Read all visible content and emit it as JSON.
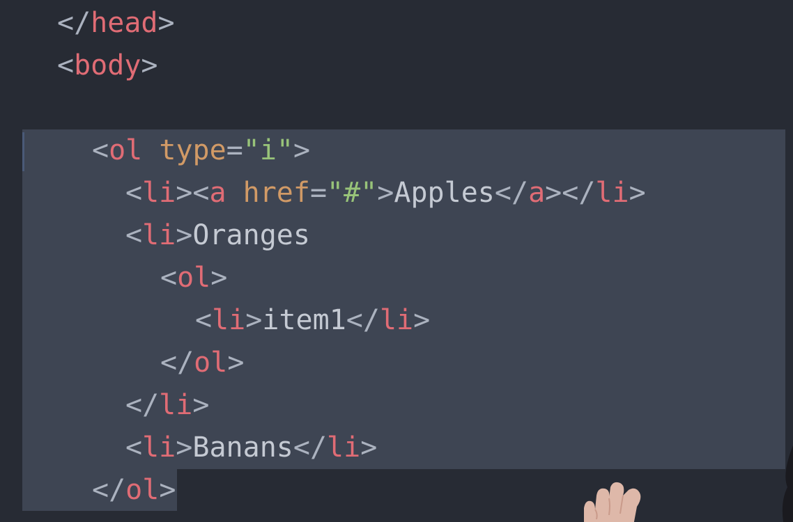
{
  "code_lines": [
    [
      {
        "t": "</",
        "c": "punct"
      },
      {
        "t": "head",
        "c": "tag"
      },
      {
        "t": ">",
        "c": "punct"
      }
    ],
    [
      {
        "t": "<",
        "c": "punct"
      },
      {
        "t": "body",
        "c": "tag"
      },
      {
        "t": ">",
        "c": "punct"
      }
    ],
    [],
    [
      {
        "t": "<",
        "c": "punct"
      },
      {
        "t": "ol",
        "c": "tag"
      },
      {
        "t": " ",
        "c": "punct"
      },
      {
        "t": "type",
        "c": "attr"
      },
      {
        "t": "=",
        "c": "punct"
      },
      {
        "t": "\"i\"",
        "c": "str"
      },
      {
        "t": ">",
        "c": "punct"
      }
    ],
    [
      {
        "t": "<",
        "c": "punct"
      },
      {
        "t": "li",
        "c": "tag"
      },
      {
        "t": "><",
        "c": "punct"
      },
      {
        "t": "a",
        "c": "tag"
      },
      {
        "t": " ",
        "c": "punct"
      },
      {
        "t": "href",
        "c": "attr"
      },
      {
        "t": "=",
        "c": "punct"
      },
      {
        "t": "\"#\"",
        "c": "str"
      },
      {
        "t": ">",
        "c": "punct"
      },
      {
        "t": "Apples",
        "c": "txt"
      },
      {
        "t": "</",
        "c": "punct"
      },
      {
        "t": "a",
        "c": "tag"
      },
      {
        "t": "></",
        "c": "punct"
      },
      {
        "t": "li",
        "c": "tag"
      },
      {
        "t": ">",
        "c": "punct"
      }
    ],
    [
      {
        "t": "<",
        "c": "punct"
      },
      {
        "t": "li",
        "c": "tag"
      },
      {
        "t": ">",
        "c": "punct"
      },
      {
        "t": "Oranges",
        "c": "txt"
      }
    ],
    [
      {
        "t": "<",
        "c": "punct"
      },
      {
        "t": "ol",
        "c": "tag"
      },
      {
        "t": ">",
        "c": "punct"
      }
    ],
    [
      {
        "t": "<",
        "c": "punct"
      },
      {
        "t": "li",
        "c": "tag"
      },
      {
        "t": ">",
        "c": "punct"
      },
      {
        "t": "item1",
        "c": "txt"
      },
      {
        "t": "</",
        "c": "punct"
      },
      {
        "t": "li",
        "c": "tag"
      },
      {
        "t": ">",
        "c": "punct"
      }
    ],
    [
      {
        "t": "</",
        "c": "punct"
      },
      {
        "t": "ol",
        "c": "tag"
      },
      {
        "t": ">",
        "c": "punct"
      }
    ],
    [
      {
        "t": "</",
        "c": "punct"
      },
      {
        "t": "li",
        "c": "tag"
      },
      {
        "t": ">",
        "c": "punct"
      }
    ],
    [
      {
        "t": "<",
        "c": "punct"
      },
      {
        "t": "li",
        "c": "tag"
      },
      {
        "t": ">",
        "c": "punct"
      },
      {
        "t": "Banans",
        "c": "txt"
      },
      {
        "t": "</",
        "c": "punct"
      },
      {
        "t": "li",
        "c": "tag"
      },
      {
        "t": ">",
        "c": "punct"
      }
    ],
    [
      {
        "t": "</",
        "c": "punct"
      },
      {
        "t": "ol",
        "c": "tag"
      },
      {
        "t": ">",
        "c": "punct"
      }
    ]
  ],
  "colors": {
    "background": "#272b34",
    "selection": "#3e4553",
    "tag": "#e06c75",
    "attribute": "#d19a66",
    "string": "#98c379",
    "text": "#c5cad3",
    "punctuation": "#abb2bf"
  }
}
